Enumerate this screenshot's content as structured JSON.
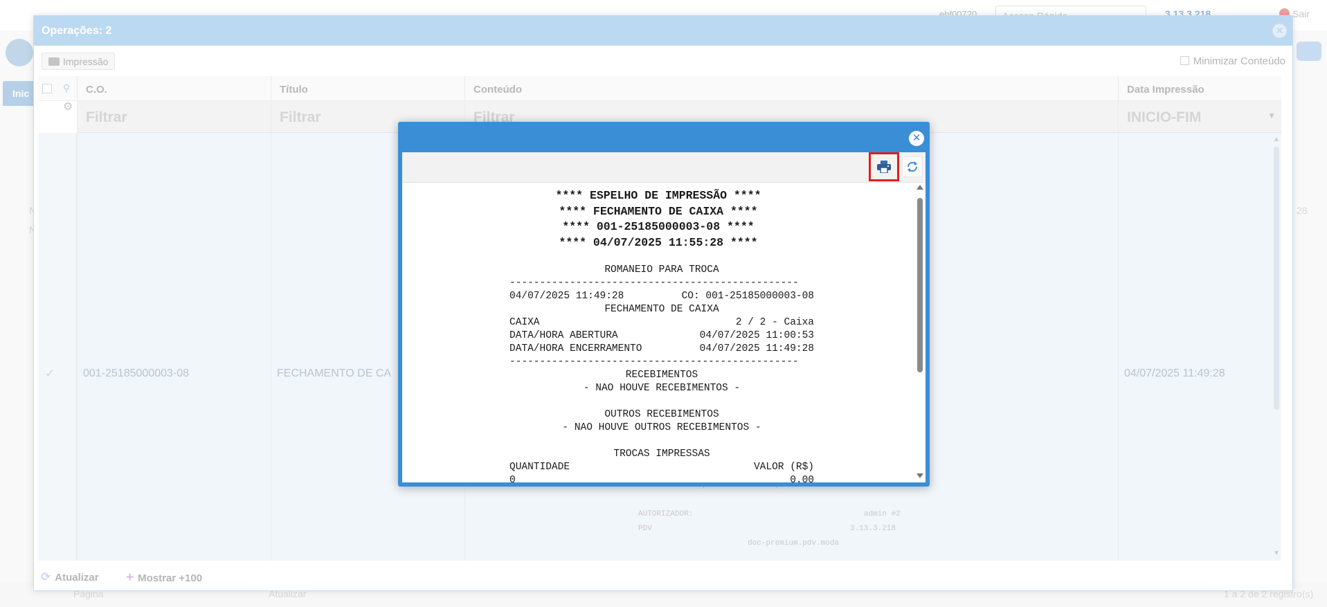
{
  "background": {
    "user": "ebf00720",
    "quick_access_placeholder": "Acesso Rápido",
    "version": "3.13.3.218",
    "exit_label": "Sair",
    "tab_label": "Inic",
    "footer_page_label": "Página",
    "footer_update_label": "Atualizar",
    "footer_count": "1 a 2 de 2 registro(s)",
    "row_text_1": "N",
    "row_text_2": "N",
    "row_value_right": "28"
  },
  "operations": {
    "title": "Operações: 2",
    "print_button": "Impressão",
    "minimize_label": "Minimizar Conteúdo",
    "columns": [
      "C.O.",
      "Título",
      "Conteúdo",
      "Data Impressão"
    ],
    "filters": [
      "Filtrar",
      "Filtrar",
      "Filtrar",
      "INICIO-FIM"
    ],
    "row": {
      "co": "001-25185000003-08",
      "title": "FECHAMENTO DE CA",
      "date": "04/07/2025 11:49:28"
    },
    "background_mirror": {
      "line1": "VL. SISTEMA | VL. CONFERIDO | VL. DIFERENCA",
      "authorizer_label": "AUTORIZADOR:",
      "authorizer_value": "admin #2",
      "pdv_label": "PDV",
      "pdv_value": "3.13.3.218",
      "footer": "doc-premium.pdv.moda"
    },
    "footer_update": "Atualizar",
    "footer_more": "Mostrar +100"
  },
  "print_preview": {
    "headers": [
      "**** ESPELHO DE IMPRESSÃO ****",
      "**** FECHAMENTO DE CAIXA ****",
      "**** 001-25185000003-08 ****",
      "**** 04/07/2025 11:55:28 ****"
    ],
    "section_title": "ROMANEIO PARA TROCA",
    "separator": "------------------------------------------------",
    "datetime": "04/07/2025 11:49:28",
    "co_label": "CO: 001-25185000003-08",
    "subtitle": "FECHAMENTO DE CAIXA",
    "caixa_label": "CAIXA",
    "caixa_value": "2 / 2 - Caixa",
    "abertura_label": "DATA/HORA ABERTURA",
    "abertura_value": "04/07/2025 11:00:53",
    "encerramento_label": "DATA/HORA ENCERRAMENTO",
    "encerramento_value": "04/07/2025 11:49:28",
    "recebimentos_title": "RECEBIMENTOS",
    "recebimentos_none": "- NAO HOUVE RECEBIMENTOS -",
    "outros_title": "OUTROS RECEBIMENTOS",
    "outros_none": "- NAO HOUVE OUTROS RECEBIMENTOS -",
    "trocas_title": "TROCAS IMPRESSAS",
    "qty_label": "QUANTIDADE",
    "valor_label": "VALOR (R$)",
    "qty_value": "0",
    "valor_value": "0.00"
  }
}
